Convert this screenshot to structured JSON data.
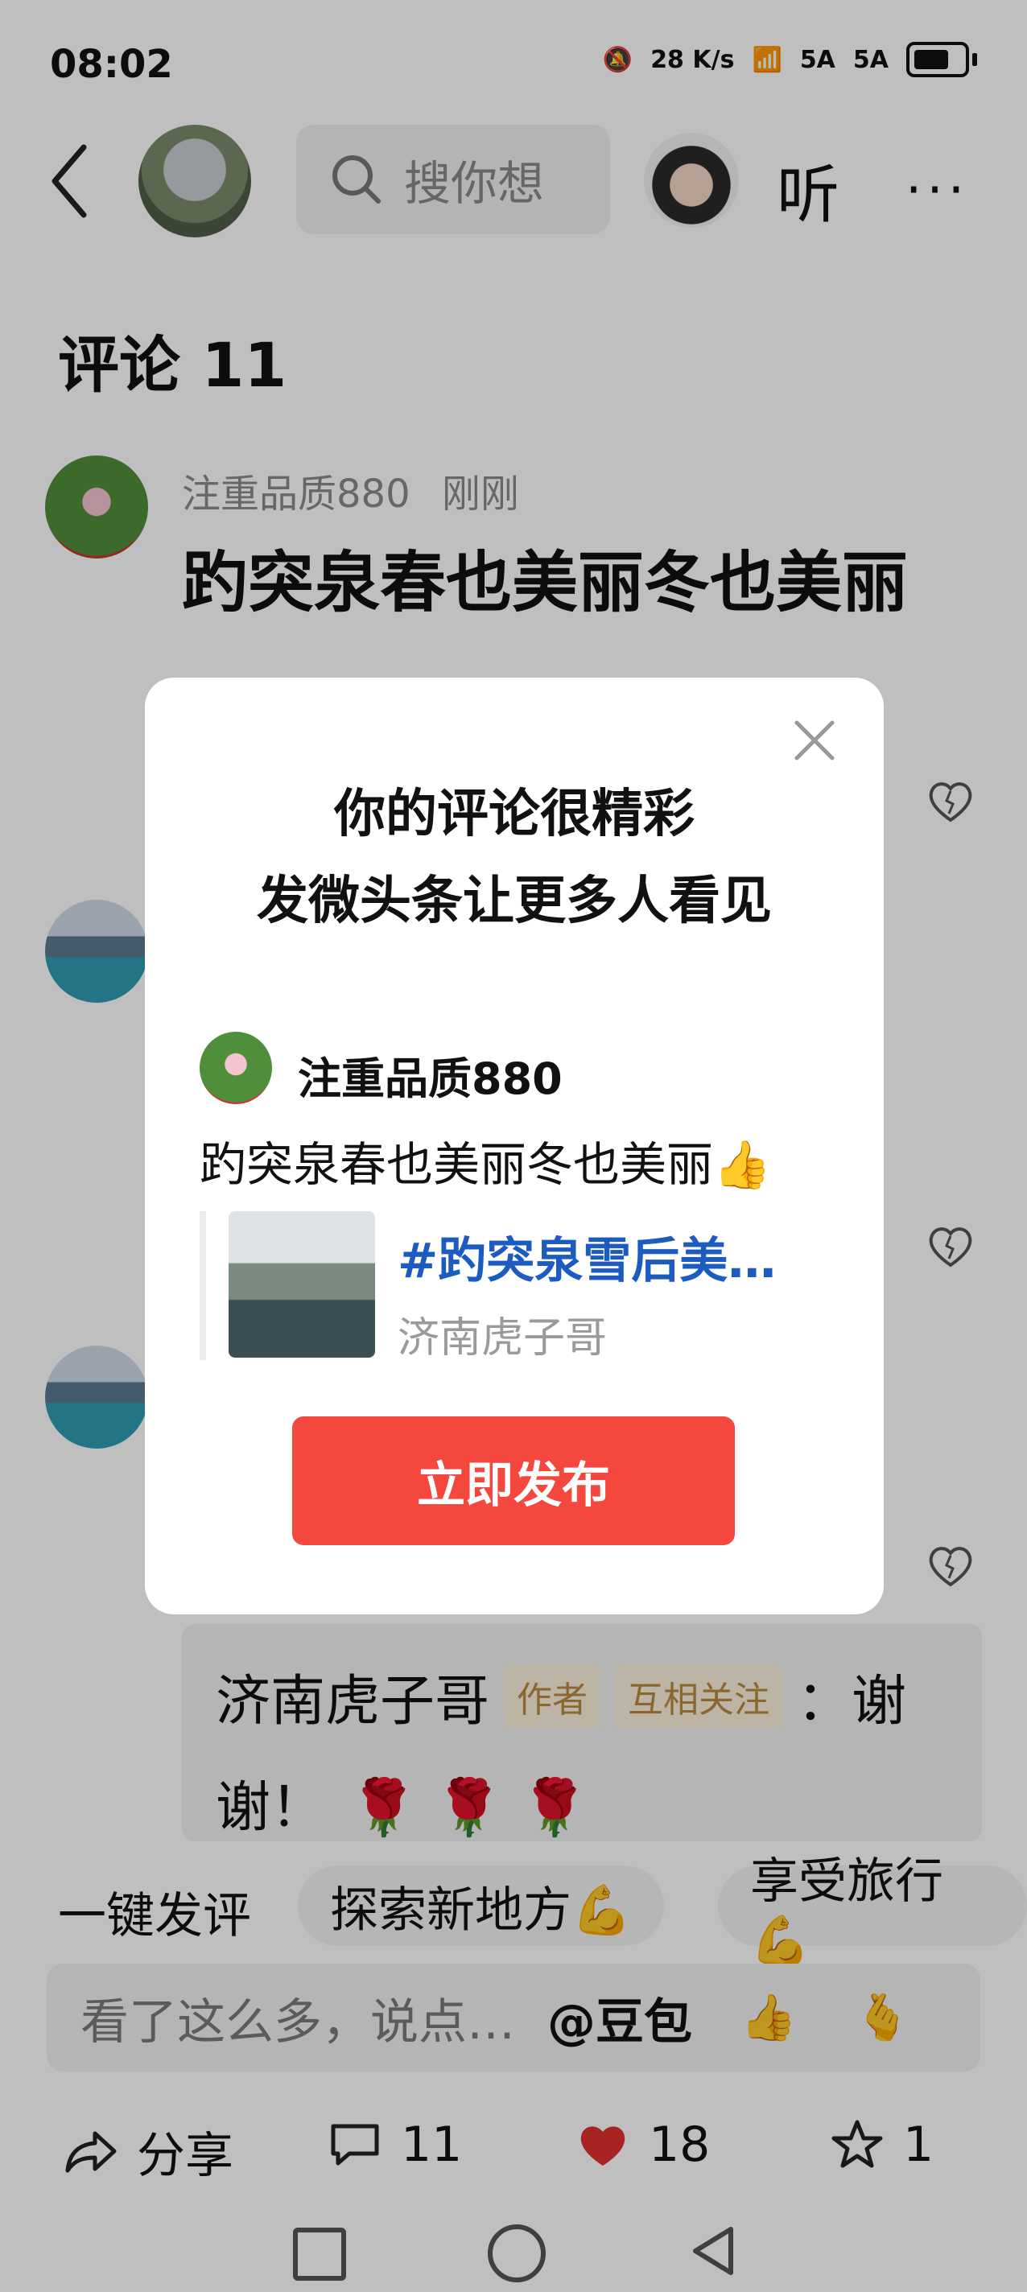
{
  "status_bar": {
    "time": "08:02",
    "net_speed": "28 K/s",
    "signal1": "5A",
    "signal2": "5A"
  },
  "header": {
    "search_placeholder": "搜你想",
    "listen_label": "听",
    "more_label": "···"
  },
  "comments": {
    "title": "评论 11",
    "first": {
      "user": "注重品质880",
      "time": "刚刚",
      "text": "趵突泉春也美丽冬也美丽"
    }
  },
  "reply": {
    "author": "济南虎子哥",
    "tag_author": "作者",
    "tag_follow": "互相关注",
    "text_line1": "：谢",
    "text_line2": "谢！",
    "roses": "🌹 🌹 🌹"
  },
  "quick_comment": {
    "label": "一键发评",
    "chips": [
      "探索新地方💪",
      "享受旅行💪"
    ]
  },
  "input": {
    "placeholder": "看了这么多，说点…",
    "mention": "@豆包",
    "emoji1": "👍",
    "emoji2": "🫰"
  },
  "bottom": {
    "share": "分享",
    "comments": "11",
    "likes": "18",
    "favorites": "1"
  },
  "modal": {
    "title_line1": "你的评论很精彩",
    "title_line2": "发微头条让更多人看见",
    "user": "注重品质880",
    "text": "趵突泉春也美丽冬也美丽👍",
    "topic": "#趵突泉雪后美…",
    "author": "济南虎子哥",
    "publish_label": "立即发布"
  },
  "colors": {
    "accent": "#f4473e",
    "link": "#1c5bbf",
    "like": "#e0302e"
  }
}
